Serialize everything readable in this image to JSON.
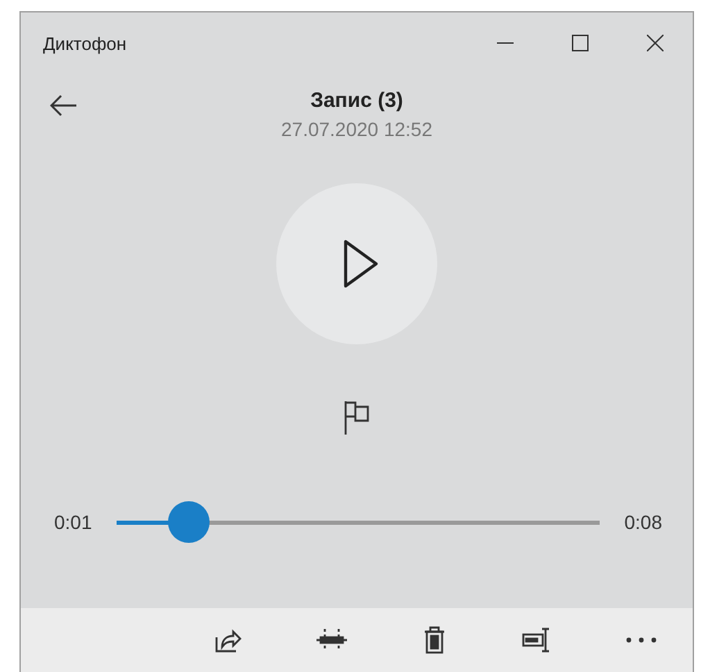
{
  "window": {
    "title": "Диктофон"
  },
  "recording": {
    "name": "Запис (3)",
    "date": "27.07.2020 12:52"
  },
  "playback": {
    "elapsed": "0:01",
    "total": "0:08",
    "level": 0.15
  },
  "toolbar": [
    {
      "kind": "share"
    },
    {
      "kind": "trim"
    },
    {
      "kind": "delete"
    },
    {
      "kind": "rename"
    },
    {
      "kind": "more"
    }
  ]
}
